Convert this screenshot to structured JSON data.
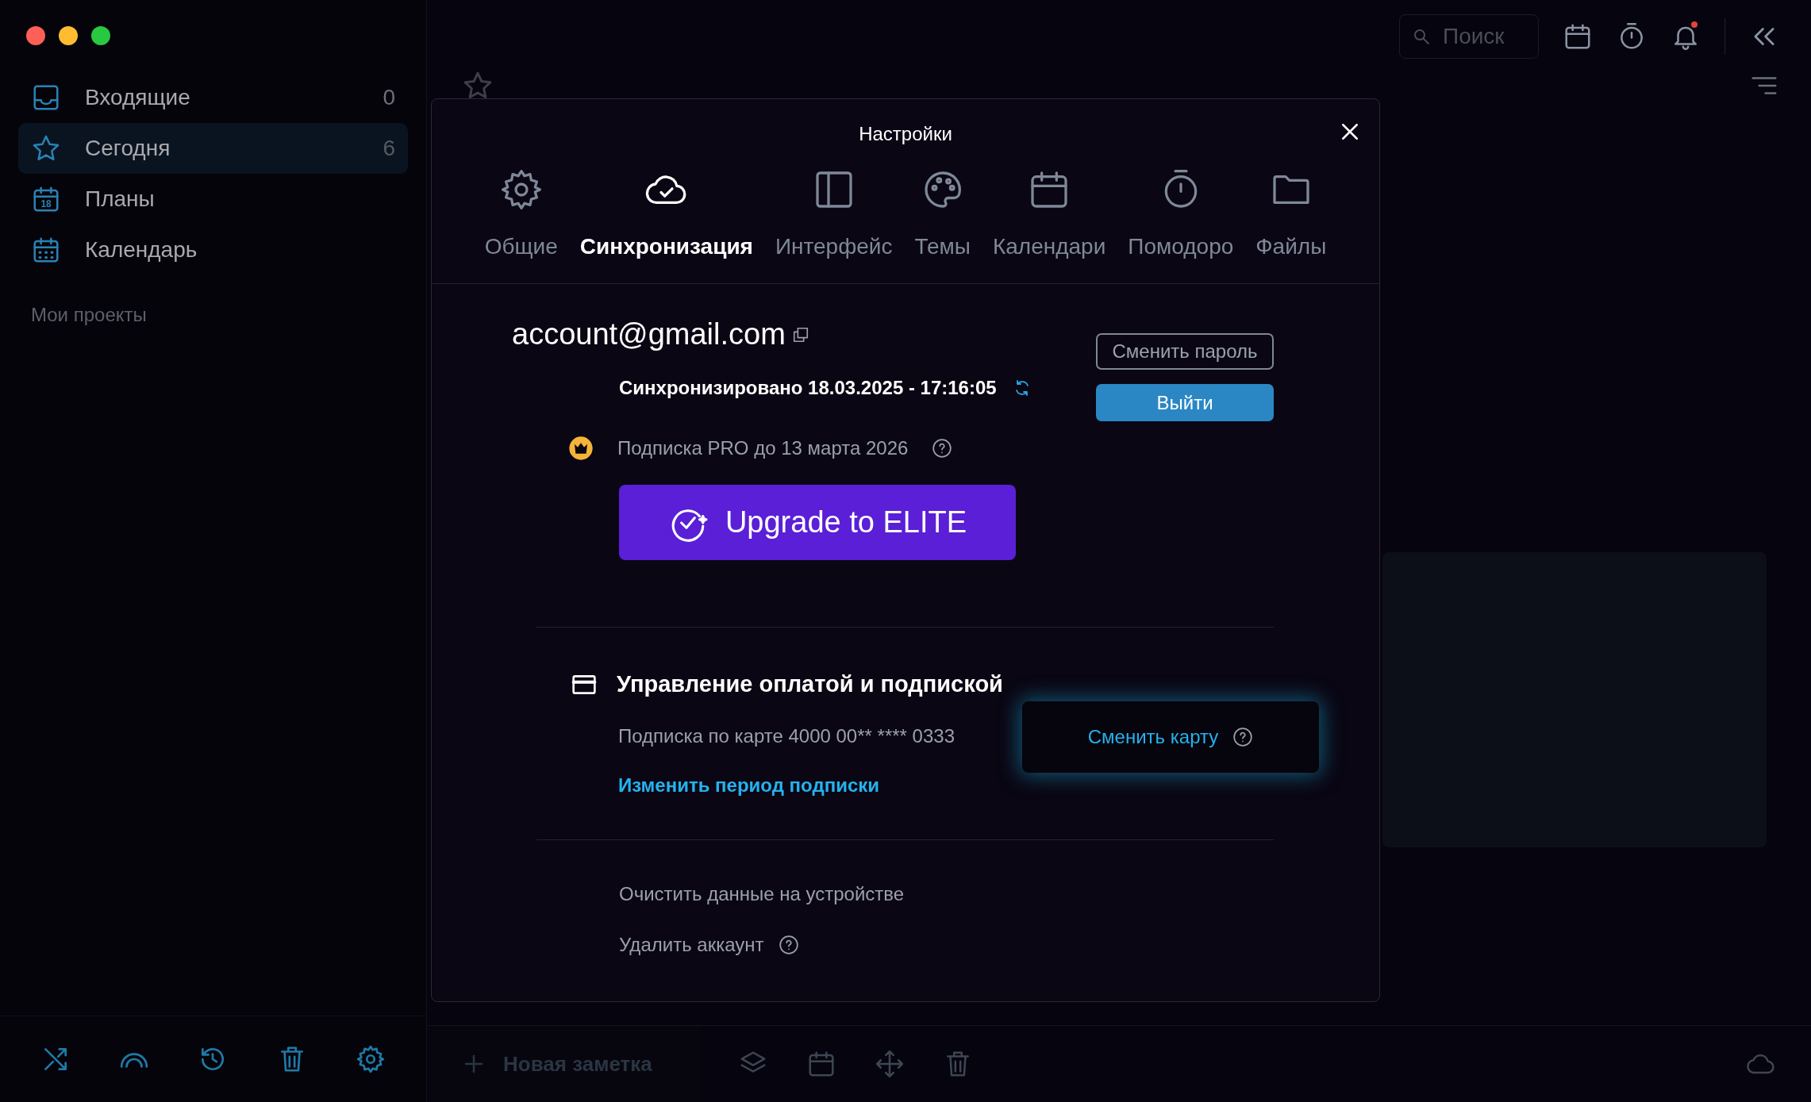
{
  "window": {
    "controls": [
      {
        "color": "#fe5f57"
      },
      {
        "color": "#febc2e"
      },
      {
        "color": "#28c840"
      }
    ]
  },
  "sidebar": {
    "items": [
      {
        "kind": "inbox",
        "label": "Входящие",
        "count": "0",
        "selected": false
      },
      {
        "kind": "star",
        "label": "Сегодня",
        "count": "6",
        "selected": true
      },
      {
        "kind": "plans",
        "label": "Планы",
        "icon_text": "18",
        "selected": false
      },
      {
        "kind": "calendar",
        "label": "Календарь",
        "selected": false
      }
    ],
    "section_title": "Мои проекты",
    "footer_icons": [
      {
        "kind": "shuffle"
      },
      {
        "kind": "arc"
      },
      {
        "kind": "history"
      },
      {
        "kind": "trash"
      },
      {
        "kind": "gear"
      }
    ]
  },
  "toolbar": {
    "search": {
      "placeholder": "Поиск"
    },
    "icons": [
      {
        "kind": "calendar",
        "notification": false
      },
      {
        "kind": "timer",
        "notification": false
      },
      {
        "kind": "bell",
        "notification": true
      }
    ]
  },
  "main": {
    "new_note": "Новая заметка",
    "bottom_icons": [
      {
        "kind": "layers"
      },
      {
        "kind": "calendar"
      },
      {
        "kind": "move"
      },
      {
        "kind": "trash"
      }
    ]
  },
  "dialog": {
    "title": "Настройки",
    "tabs": [
      {
        "kind": "gear",
        "label": "Общие",
        "selected": false
      },
      {
        "kind": "cloud",
        "label": "Синхронизация",
        "selected": true
      },
      {
        "kind": "panel",
        "label": "Интерфейс",
        "selected": false
      },
      {
        "kind": "palette",
        "label": "Темы",
        "selected": false
      },
      {
        "kind": "calendar",
        "label": "Календари",
        "selected": false
      },
      {
        "kind": "timer",
        "label": "Помодоро",
        "selected": false
      },
      {
        "kind": "folder",
        "label": "Файлы",
        "selected": false
      }
    ],
    "email": "account@gmail.com",
    "sync_status": "Синхронизировано 18.03.2025 - 17:16:05",
    "change_password": "Сменить пароль",
    "logout": "Выйти",
    "subscription": "Подписка PRO до 13 марта 2026",
    "upgrade": "Upgrade to ELITE",
    "payment_title": "Управление оплатой и подпиской",
    "card_info": "Подписка по карте 4000 00** **** 0333",
    "change_period": "Изменить период подписки",
    "change_card": "Сменить карту",
    "clear_data": "Очистить данные на устройстве",
    "delete_account": "Удалить аккаунт"
  }
}
